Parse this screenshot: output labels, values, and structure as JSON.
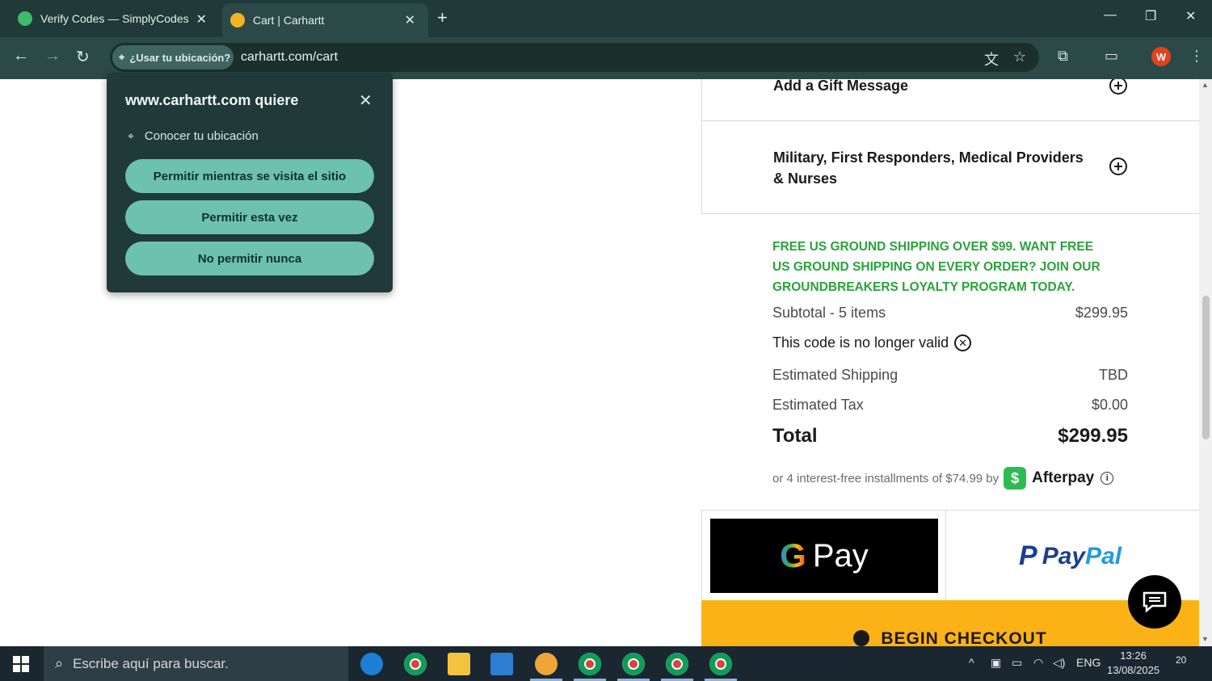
{
  "browser": {
    "tabs": [
      {
        "title": "Verify Codes — SimplyCodes",
        "active": false
      },
      {
        "title": "Cart | Carhartt",
        "active": true
      }
    ],
    "location_chip": "¿Usar tu ubicación?",
    "url": "carhartt.com/cart",
    "profile_initial": "W"
  },
  "permission_popup": {
    "title": "www.carhartt.com quiere",
    "permission": "Conocer tu ubicación",
    "buttons": [
      "Permitir mientras se visita el sitio",
      "Permitir esta vez",
      "No permitir nunca"
    ]
  },
  "cart": {
    "accordion": [
      {
        "label": "Add a Gift Message"
      },
      {
        "label_line1": "Military, First Responders, Medical Providers",
        "label_line2": "& Nurses"
      }
    ],
    "promo": "FREE US GROUND SHIPPING OVER $99. WANT FREE US GROUND SHIPPING ON EVERY ORDER? JOIN OUR GROUNDBREAKERS LOYALTY PROGRAM TODAY.",
    "subtotal_label": "Subtotal - 5 items",
    "subtotal_value": "$299.95",
    "code_message": "This code is no longer valid",
    "shipping_label": "Estimated Shipping",
    "shipping_value": "TBD",
    "tax_label": "Estimated Tax",
    "tax_value": "$0.00",
    "total_label": "Total",
    "total_value": "$299.95",
    "afterpay_text": "or 4 interest-free installments of $74.99 by",
    "afterpay_brand": "Afterpay",
    "gpay_label": "Pay",
    "paypal_label_1": "Pay",
    "paypal_label_2": "Pal",
    "checkout_label": "BEGIN CHECKOUT"
  },
  "taskbar": {
    "search_placeholder": "Escribe aquí para buscar.",
    "language": "ENG",
    "time": "13:26",
    "date": "13/08/2025",
    "notification_count": "20"
  },
  "colors": {
    "chrome_bg": "#1f3a38",
    "toolbar_bg": "#2b4a47",
    "promo_green": "#2aa33a",
    "checkout_yellow": "#fbb217",
    "popup_button": "#6cc1b1"
  }
}
